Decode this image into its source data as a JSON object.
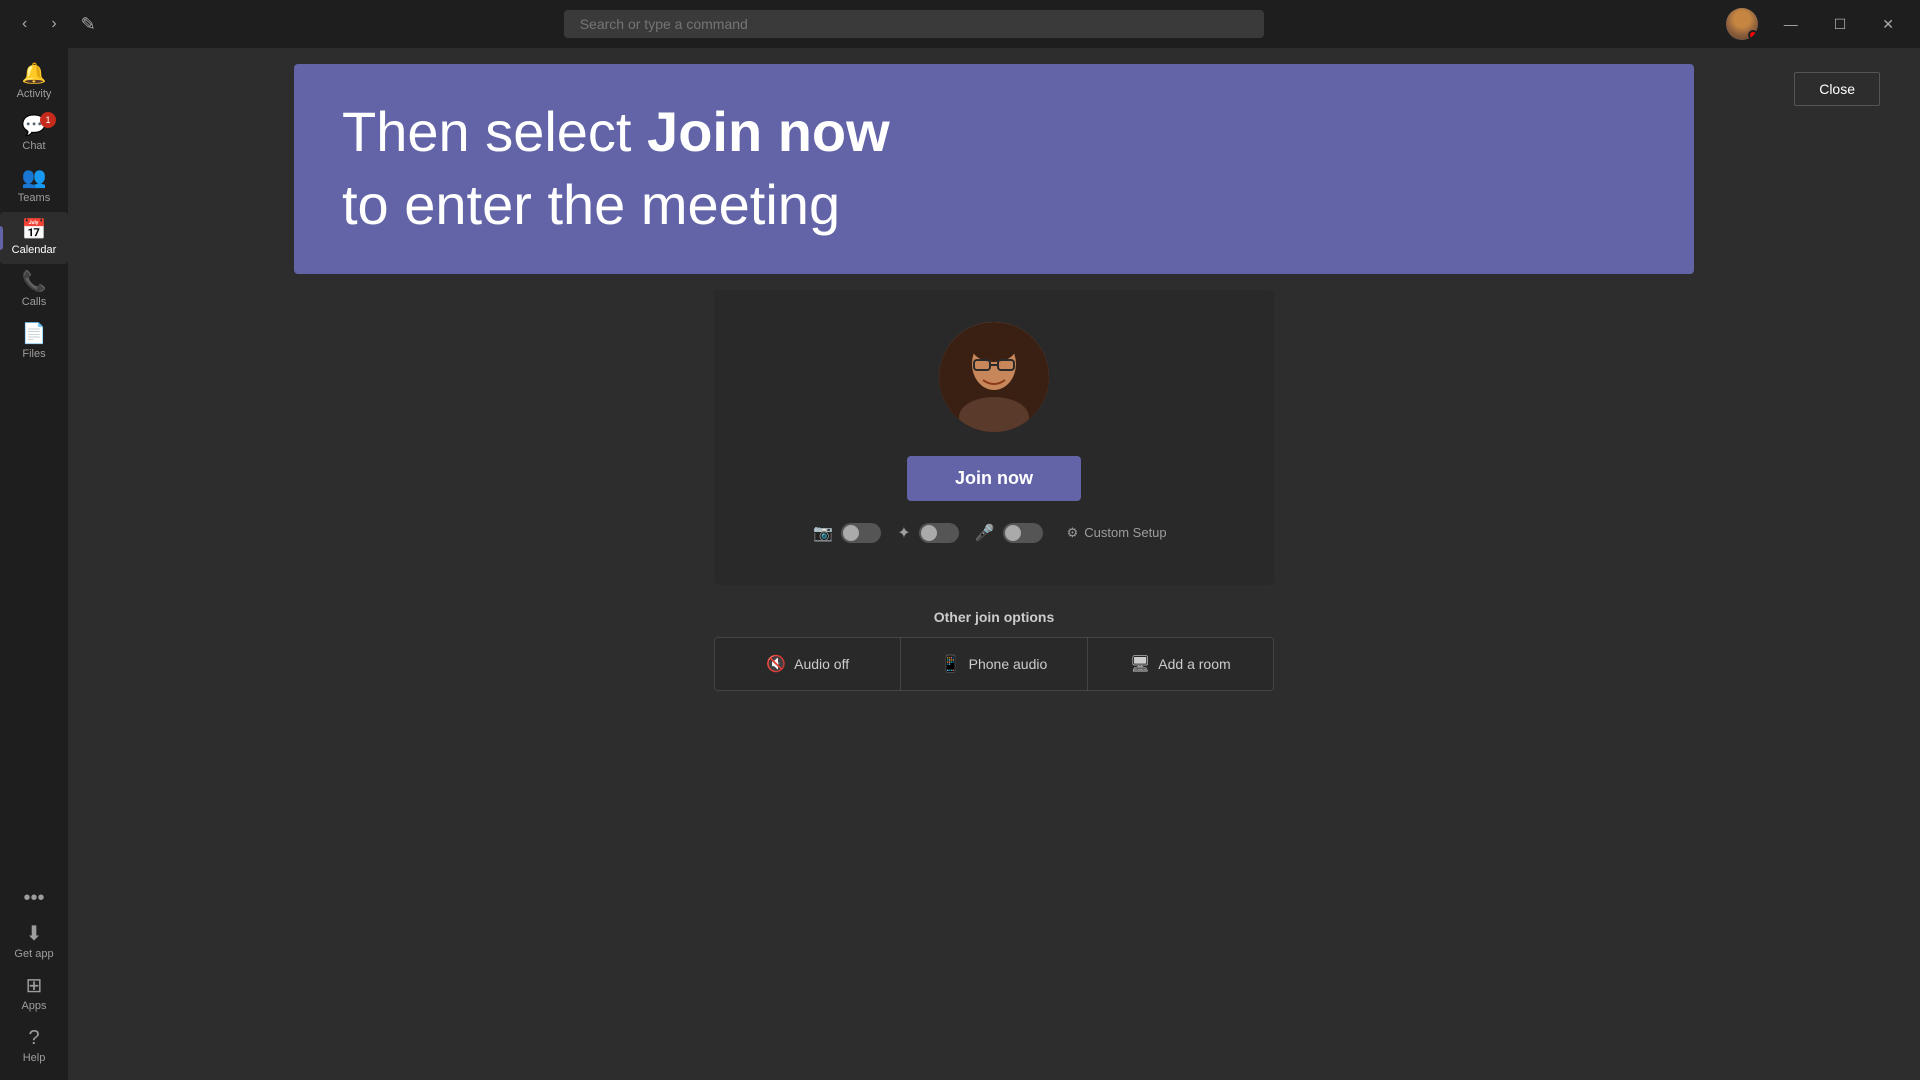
{
  "titleBar": {
    "searchPlaceholder": "Search or type a command",
    "backBtn": "‹",
    "forwardBtn": "›",
    "composeBtn": "✎",
    "minimizeBtn": "—",
    "maximizeBtn": "☐",
    "closeBtn": "✕"
  },
  "sidebar": {
    "items": [
      {
        "id": "activity",
        "label": "Activity",
        "icon": "🔔",
        "badge": null
      },
      {
        "id": "chat",
        "label": "Chat",
        "icon": "💬",
        "badge": "1"
      },
      {
        "id": "teams",
        "label": "Teams",
        "icon": "👥",
        "badge": null
      },
      {
        "id": "calendar",
        "label": "Calendar",
        "icon": "📅",
        "badge": null
      },
      {
        "id": "calls",
        "label": "Calls",
        "icon": "📞",
        "badge": null
      },
      {
        "id": "files",
        "label": "Files",
        "icon": "📄",
        "badge": null
      }
    ],
    "bottomItems": [
      {
        "id": "more",
        "label": "...",
        "icon": "···",
        "badge": null
      },
      {
        "id": "getapp",
        "label": "Get app",
        "icon": "⬇",
        "badge": null
      },
      {
        "id": "apps",
        "label": "Apps",
        "icon": "⊞",
        "badge": null
      },
      {
        "id": "help",
        "label": "Help",
        "icon": "?",
        "badge": null
      }
    ]
  },
  "instructionBanner": {
    "line1Normal": "Then select ",
    "line1Bold": "Join now",
    "line2": "to enter the meeting"
  },
  "closePanelBtn": "Close",
  "joinPanel": {
    "joinNowLabel": "Join now",
    "controls": [
      {
        "id": "video",
        "icon": "📷"
      },
      {
        "id": "blur",
        "icon": "✦"
      },
      {
        "id": "mic",
        "icon": "🎤"
      }
    ],
    "customSetupLabel": "Custom Setup",
    "customSetupIcon": "⚙"
  },
  "otherOptions": {
    "title": "Other join options",
    "options": [
      {
        "id": "audio-off",
        "icon": "🔇",
        "label": "Audio off"
      },
      {
        "id": "phone-audio",
        "icon": "📱",
        "label": "Phone audio"
      },
      {
        "id": "add-room",
        "icon": "🖥",
        "label": "Add a room"
      }
    ]
  }
}
